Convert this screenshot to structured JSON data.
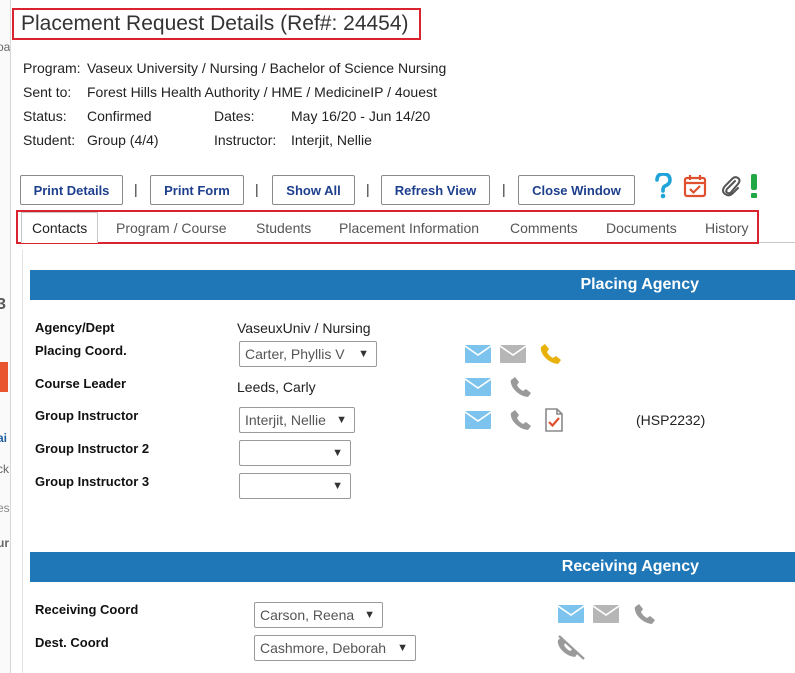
{
  "window": {
    "title": "Placement Request Details (Ref#: 24454)"
  },
  "info": {
    "program_label": "Program:",
    "program_value": "Vaseux University / Nursing / Bachelor of Science Nursing",
    "sent_to_label": "Sent to:",
    "sent_to_value": "Forest Hills Health Authority / HME / MedicineIP / 4ouest",
    "status_label": "Status:",
    "status_value": "Confirmed",
    "dates_label": "Dates:",
    "dates_value": "May 16/20 - Jun 14/20",
    "student_label": "Student:",
    "student_value": "Group (4/4)",
    "instructor_label": "Instructor:",
    "instructor_value": "Interjit, Nellie"
  },
  "toolbar": {
    "print_details": "Print Details",
    "print_form": "Print Form",
    "show_all": "Show All",
    "refresh_view": "Refresh View",
    "close_window": "Close Window",
    "separator": "|"
  },
  "tabs": [
    {
      "label": "Contacts",
      "active": true
    },
    {
      "label": "Program / Course"
    },
    {
      "label": "Students"
    },
    {
      "label": "Placement Information"
    },
    {
      "label": "Comments"
    },
    {
      "label": "Documents"
    },
    {
      "label": "History"
    }
  ],
  "placing": {
    "header": "Placing Agency",
    "agency_label": "Agency/Dept",
    "agency_value": "VaseuxUniv / Nursing",
    "placing_coord_label": "Placing Coord.",
    "placing_coord_value": "Carter, Phyllis V",
    "course_leader_label": "Course Leader",
    "course_leader_value": "Leeds, Carly",
    "group_instructor_label": "Group Instructor",
    "group_instructor_value": "Interjit, Nellie",
    "group_instructor_code": "(HSP2232)",
    "group_instructor2_label": "Group Instructor 2",
    "group_instructor2_value": "",
    "group_instructor3_label": "Group Instructor 3",
    "group_instructor3_value": ""
  },
  "receiving": {
    "header": "Receiving Agency",
    "receiving_coord_label": "Receiving Coord",
    "receiving_coord_value": "Carson, Reena",
    "dest_coord_label": "Dest. Coord",
    "dest_coord_value": "Cashmore, Deborah"
  },
  "colors": {
    "title_border": "#d9232e",
    "section_header": "#1f77b8",
    "button_text": "#1d3f8e",
    "email_icon": "#7cc4ee",
    "phone_active": "#e8b10c",
    "phone_inactive": "#9a9a9a",
    "help_icon": "#1fa3d8",
    "calendar_icon": "#e0502f",
    "alert_icon": "#20a845"
  },
  "icons": {
    "help": "question-mark-icon",
    "calendar": "calendar-check-icon",
    "attach": "paperclip-icon",
    "alert": "exclamation-icon",
    "email": "envelope-icon",
    "phone": "phone-icon",
    "document": "document-check-icon",
    "no_phone": "phone-disabled-icon"
  },
  "sliver_text": [
    "oa",
    "3",
    "ai",
    "ck",
    "es",
    "ur"
  ]
}
